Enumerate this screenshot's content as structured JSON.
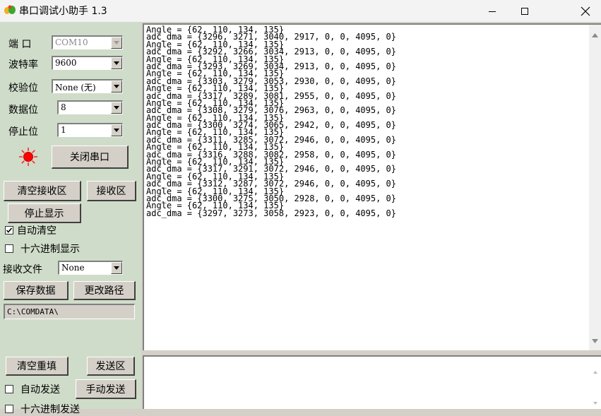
{
  "window": {
    "title": "串口调试小助手 1.3",
    "icon": "app-icon"
  },
  "settings": {
    "port_label": "端  口",
    "port_value": "COM10",
    "baud_label": "波特率",
    "baud_value": "9600",
    "parity_label": "校验位",
    "parity_value": "None (无)",
    "databits_label": "数据位",
    "databits_value": "8",
    "stopbits_label": "停止位",
    "stopbits_value": "1",
    "status_led_color": "#ff0000",
    "close_port_label": "关闭串口"
  },
  "receive": {
    "clear_label": "清空接收区",
    "area_label": "接收区",
    "stop_display_label": "停止显示",
    "auto_clear_label": "自动清空",
    "auto_clear_checked": true,
    "hex_display_label": "十六进制显示",
    "hex_display_checked": false,
    "file_label": "接收文件",
    "file_value": "None",
    "save_label": "保存数据",
    "change_path_label": "更改路径",
    "path_value": "C:\\COMDATA\\",
    "lines": [
      "Angle = {62, 110, 134, 135}",
      "adc_dma = {3296, 3271, 3040, 2917, 0, 0, 4095, 0}",
      "Angle = {62, 110, 134, 135}",
      "adc_dma = {3292, 3266, 3034, 2913, 0, 0, 4095, 0}",
      "Angle = {62, 110, 134, 135}",
      "adc_dma = {3293, 3269, 3034, 2913, 0, 0, 4095, 0}",
      "Angle = {62, 110, 134, 135}",
      "adc_dma = {3303, 3279, 3053, 2930, 0, 0, 4095, 0}",
      "Angle = {62, 110, 134, 135}",
      "adc_dma = {3317, 3289, 3081, 2955, 0, 0, 4095, 0}",
      "Angle = {62, 110, 134, 135}",
      "adc_dma = {3308, 3279, 3076, 2963, 0, 0, 4095, 0}",
      "Angle = {62, 110, 134, 135}",
      "adc_dma = {3300, 3274, 3065, 2942, 0, 0, 4095, 0}",
      "Angle = {62, 110, 134, 135}",
      "adc_dma = {3311, 3285, 3072, 2946, 0, 0, 4095, 0}",
      "Angle = {62, 110, 134, 135}",
      "adc_dma = {3316, 3288, 3082, 2958, 0, 0, 4095, 0}",
      "Angle = {62, 110, 134, 135}",
      "adc_dma = {3317, 3291, 3072, 2946, 0, 0, 4095, 0}",
      "Angle = {62, 110, 134, 135}",
      "adc_dma = {3312, 3287, 3072, 2946, 0, 0, 4095, 0}",
      "Angle = {62, 110, 134, 135}",
      "adc_dma = {3300, 3275, 3050, 2928, 0, 0, 4095, 0}",
      "Angle = {62, 110, 134, 135}",
      "adc_dma = {3297, 3273, 3058, 2923, 0, 0, 4095, 0}"
    ]
  },
  "send": {
    "clear_refill_label": "清空重填",
    "area_label": "发送区",
    "auto_send_label": "自动发送",
    "auto_send_checked": false,
    "manual_send_label": "手动发送",
    "hex_send_label": "十六进制发送",
    "hex_send_checked": false
  }
}
